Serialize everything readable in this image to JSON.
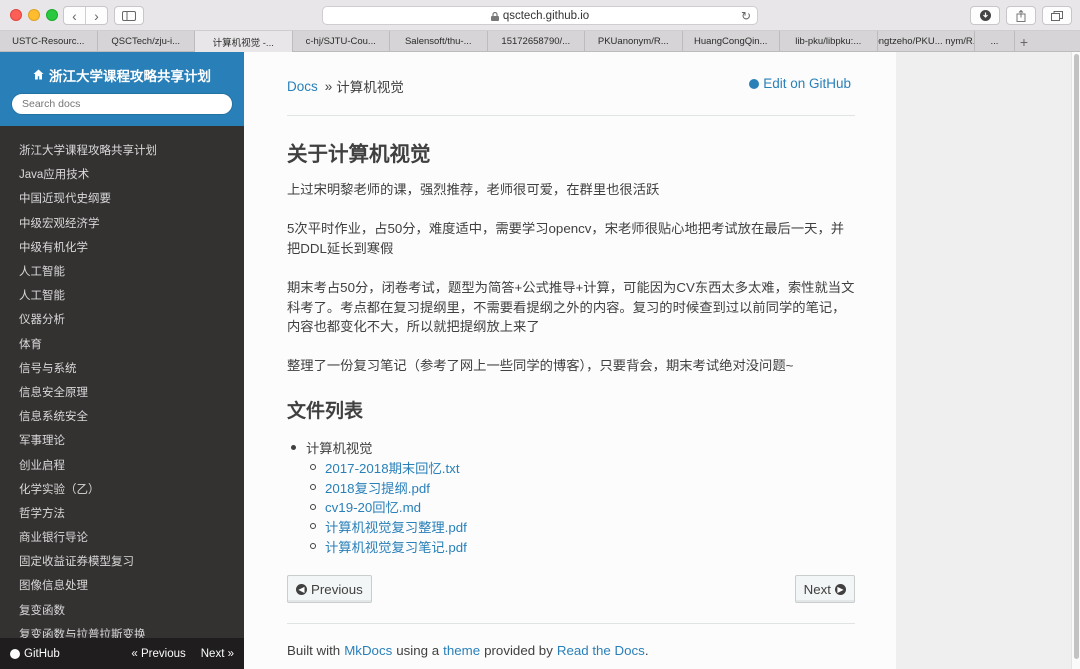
{
  "browser": {
    "url": "qsctech.github.io",
    "tabs": [
      {
        "label": "USTC-Resourc...",
        "active": false
      },
      {
        "label": "QSCTech/zju-i...",
        "active": false
      },
      {
        "label": "计算机视觉 -...",
        "active": true
      },
      {
        "label": "c-hj/SJTU-Cou...",
        "active": false
      },
      {
        "label": "Salensoft/thu-...",
        "active": false
      },
      {
        "label": "15172658790/...",
        "active": false
      },
      {
        "label": "PKUanonym/R...",
        "active": false
      },
      {
        "label": "HuangCongQin...",
        "active": false
      },
      {
        "label": "lib-pku/libpku:...",
        "active": false
      },
      {
        "label": "tongtzeho/PKU... nym/R...",
        "active": false
      },
      {
        "label": "...",
        "active": false
      }
    ]
  },
  "sidebar": {
    "title": "浙江大学课程攻略共享计划",
    "search_placeholder": "Search docs",
    "items": [
      "浙江大学课程攻略共享计划",
      "Java应用技术",
      "中国近现代史纲要",
      "中级宏观经济学",
      "中级有机化学",
      "人工智能",
      "人工智能",
      "仪器分析",
      "体育",
      "信号与系统",
      "信息安全原理",
      "信息系统安全",
      "军事理论",
      "创业启程",
      "化学实验（乙）",
      "哲学方法",
      "商业银行导论",
      "固定收益证券模型复习",
      "图像信息处理",
      "复变函数",
      "复变函数与拉普拉斯变换"
    ],
    "footer": {
      "github": "GitHub",
      "previous": "« Previous",
      "next": "Next »"
    }
  },
  "main": {
    "breadcrumb": {
      "docs": "Docs",
      "separator": "»",
      "current": "计算机视觉"
    },
    "edit_link": "Edit on GitHub",
    "title": "关于计算机视觉",
    "paragraphs": [
      "上过宋明黎老师的课，强烈推荐，老师很可爱，在群里也很活跃",
      "5次平时作业，占50分，难度适中，需要学习opencv，宋老师很贴心地把考试放在最后一天，并把DDL延长到寒假",
      "期末考占50分，闭卷考试，题型为简答+公式推导+计算，可能因为CV东西太多太难，索性就当文科考了。考点都在复习提纲里，不需要看提纲之外的内容。复习的时候查到过以前同学的笔记，内容也都变化不大，所以就把提纲放上来了",
      "整理了一份复习笔记（参考了网上一些同学的博客），只要背会，期末考试绝对没问题~"
    ],
    "files_title": "文件列表",
    "folder": "计算机视觉",
    "files": [
      "2017-2018期末回忆.txt",
      "2018复习提纲.pdf",
      "cv19-20回忆.md",
      "计算机视觉复习整理.pdf",
      "计算机视觉复习笔记.pdf"
    ],
    "prev_button": "Previous",
    "next_button": "Next",
    "footer": {
      "built_with": "Built with",
      "mkdocs": "MkDocs",
      "using_a": "using a",
      "theme": "theme",
      "provided_by": "provided by",
      "rtd": "Read the Docs",
      "period": "."
    }
  }
}
